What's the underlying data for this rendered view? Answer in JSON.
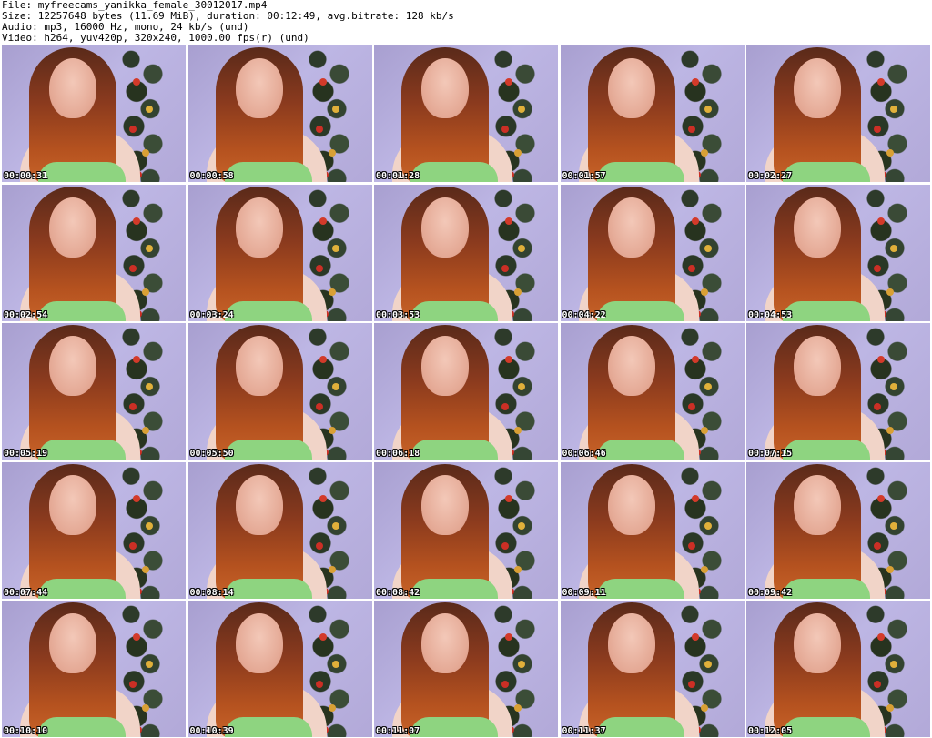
{
  "header": {
    "file_line": "File: myfreecams_yanikka_female_30012017.mp4",
    "size_line": "Size: 12257648 bytes (11.69 MiB), duration: 00:12:49, avg.bitrate: 128 kb/s",
    "audio_line": "Audio: mp3, 16000 Hz, mono, 24 kb/s (und)",
    "video_line": "Video: h264, yuv420p, 320x240, 1000.00 fps(r) (und)"
  },
  "thumbnails": [
    "00:00:31",
    "00:00:58",
    "00:01:28",
    "00:01:57",
    "00:02:27",
    "00:02:54",
    "00:03:24",
    "00:03:53",
    "00:04:22",
    "00:04:53",
    "00:05:19",
    "00:05:50",
    "00:06:18",
    "00:06:46",
    "00:07:15",
    "00:07:44",
    "00:08:14",
    "00:08:42",
    "00:09:11",
    "00:09:42",
    "00:10:10",
    "00:10:39",
    "00:11:07",
    "00:11:37",
    "00:12:05"
  ]
}
